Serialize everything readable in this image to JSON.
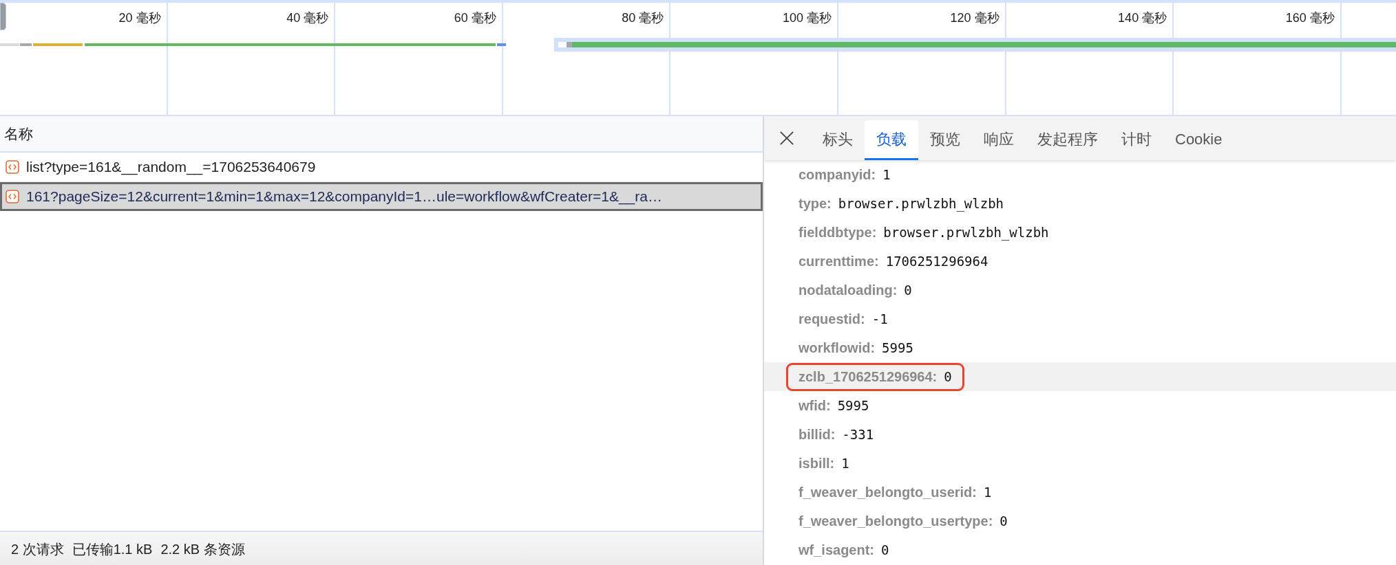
{
  "timeline": {
    "ticks": [
      "20 毫秒",
      "40 毫秒",
      "60 毫秒",
      "80 毫秒",
      "100 毫秒",
      "120 毫秒",
      "140 毫秒",
      "160 毫秒"
    ]
  },
  "requests": {
    "column": "名称",
    "rows": [
      {
        "name": "list?type=161&__random__=1706253640679",
        "selected": false
      },
      {
        "name": "161?pageSize=12&current=1&min=1&max=12&companyId=1…ule=workflow&wfCreater=1&__ra…",
        "selected": true
      }
    ]
  },
  "status_bar": {
    "items": [
      "2 次请求",
      "已传输1.1 kB",
      "2.2 kB 条资源"
    ]
  },
  "details": {
    "tabs": [
      {
        "label": "标头",
        "selected": false
      },
      {
        "label": "负载",
        "selected": true
      },
      {
        "label": "预览",
        "selected": false
      },
      {
        "label": "响应",
        "selected": false
      },
      {
        "label": "发起程序",
        "selected": false
      },
      {
        "label": "计时",
        "selected": false
      },
      {
        "label": "Cookie",
        "selected": false
      }
    ],
    "payload": [
      {
        "key": "companyid:",
        "value": "1",
        "highlighted": false,
        "boxed": false
      },
      {
        "key": "type:",
        "value": "browser.prwlzbh_wlzbh",
        "highlighted": false,
        "boxed": false
      },
      {
        "key": "fielddbtype:",
        "value": "browser.prwlzbh_wlzbh",
        "highlighted": false,
        "boxed": false
      },
      {
        "key": "currenttime:",
        "value": "1706251296964",
        "highlighted": false,
        "boxed": false
      },
      {
        "key": "nodataloading:",
        "value": "0",
        "highlighted": false,
        "boxed": false
      },
      {
        "key": "requestid:",
        "value": "-1",
        "highlighted": false,
        "boxed": false
      },
      {
        "key": "workflowid:",
        "value": "5995",
        "highlighted": false,
        "boxed": false
      },
      {
        "key": "zclb_1706251296964:",
        "value": "0",
        "highlighted": true,
        "boxed": true
      },
      {
        "key": "wfid:",
        "value": "5995",
        "highlighted": false,
        "boxed": false
      },
      {
        "key": "billid:",
        "value": "-331",
        "highlighted": false,
        "boxed": false
      },
      {
        "key": "isbill:",
        "value": "1",
        "highlighted": false,
        "boxed": false
      },
      {
        "key": "f_weaver_belongto_userid:",
        "value": "1",
        "highlighted": false,
        "boxed": false
      },
      {
        "key": "f_weaver_belongto_usertype:",
        "value": "0",
        "highlighted": false,
        "boxed": false
      },
      {
        "key": "wf_isagent:",
        "value": "0",
        "highlighted": false,
        "boxed": false
      }
    ]
  }
}
